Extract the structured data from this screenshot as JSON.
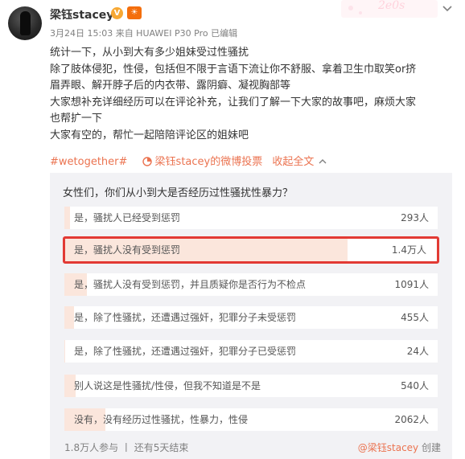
{
  "post": {
    "username": "梁钰stacey",
    "verified_badge": "V",
    "level_badge": "sun-level-icon",
    "meta": "3月24日 15:03 来自 HUAWEI P30 Pro  已编辑",
    "deco_text": "2e0s",
    "lines": [
      "统计一下，从小到大有多少姐妹受过性骚扰",
      "除了肢体侵犯，性侵，包括但不限于言语下流让你不舒服、拿着卫生巾取笑or挤",
      "眉弄眼、解开脖子后的内衣带、露阴癖、凝视胸部等",
      "大家想补充详细经历可以在评论补充，让我们了解一下大家的故事吧，麻烦大家",
      "也帮扩一下",
      "大家有空的，帮忙一起陪陪评论区的姐妹吧"
    ],
    "hashtag": "#wetogether#",
    "poll_link": "梁钰stacey的微博投票",
    "expand": "收起全文",
    "colors": {
      "accent": "#eb7350",
      "highlight_border": "#e23a34",
      "bar_fill": "#fbe6dc",
      "poll_bg": "#f2f2f5"
    }
  },
  "poll": {
    "question": "女性们，你们从小到大是否经历过性骚扰性暴力？",
    "options": [
      {
        "label": "是，骚扰人已经受到惩罚",
        "count": "293人",
        "percent": 1.5
      },
      {
        "label": "是，骚扰人没有受到惩罚",
        "count": "1.4万人",
        "percent": 76
      },
      {
        "label": "是，骚扰人没有受到惩罚，并且质疑你是否行为不检点",
        "count": "1091人",
        "percent": 6
      },
      {
        "label": "是，除了性骚扰，还遭遇过强奸，犯罪分子未受惩罚",
        "count": "455人",
        "percent": 2.5
      },
      {
        "label": "是，除了性骚扰，还遭遇过强奸，犯罪分子已受惩罚",
        "count": "24人",
        "percent": 0.1
      },
      {
        "label": "别人说这是性骚扰/性侵，但我不知道是不是",
        "count": "540人",
        "percent": 3
      },
      {
        "label": "没有，没有经历过性骚扰，性暴力，性侵",
        "count": "2062人",
        "percent": 11
      }
    ],
    "footer": "1.8万人参与 丨 还有5天结束",
    "creator_name": "@梁钰stacey",
    "creator_suffix": " 创建"
  }
}
